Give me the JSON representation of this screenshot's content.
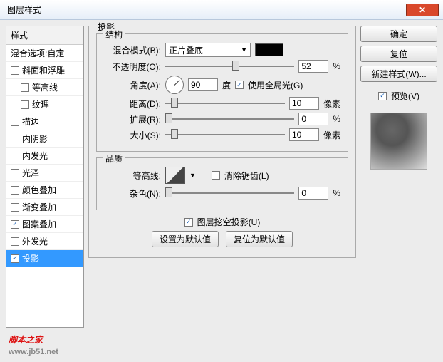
{
  "title": "图层样式",
  "styles": {
    "header": "样式",
    "blend_opts": "混合选项:自定",
    "items": [
      {
        "label": "斜面和浮雕",
        "checked": false,
        "indent": false
      },
      {
        "label": "等高线",
        "checked": false,
        "indent": true
      },
      {
        "label": "纹理",
        "checked": false,
        "indent": true
      },
      {
        "label": "描边",
        "checked": false,
        "indent": false
      },
      {
        "label": "内阴影",
        "checked": false,
        "indent": false
      },
      {
        "label": "内发光",
        "checked": false,
        "indent": false
      },
      {
        "label": "光泽",
        "checked": false,
        "indent": false
      },
      {
        "label": "颜色叠加",
        "checked": false,
        "indent": false
      },
      {
        "label": "渐变叠加",
        "checked": false,
        "indent": false
      },
      {
        "label": "图案叠加",
        "checked": true,
        "indent": false
      },
      {
        "label": "外发光",
        "checked": false,
        "indent": false
      },
      {
        "label": "投影",
        "checked": true,
        "indent": false,
        "selected": true
      }
    ]
  },
  "main": {
    "title": "投影",
    "structure": {
      "legend": "结构",
      "blend_mode_label": "混合模式(B):",
      "blend_mode_value": "正片叠底",
      "opacity_label": "不透明度(O):",
      "opacity_value": "52",
      "percent": "%",
      "angle_label": "角度(A):",
      "angle_value": "90",
      "degree": "度",
      "global_light": "使用全局光(G)",
      "distance_label": "距离(D):",
      "distance_value": "10",
      "px": "像素",
      "spread_label": "扩展(R):",
      "spread_value": "0",
      "size_label": "大小(S):",
      "size_value": "10"
    },
    "quality": {
      "legend": "品质",
      "contour_label": "等高线:",
      "antialias": "消除锯齿(L)",
      "noise_label": "杂色(N):",
      "noise_value": "0"
    },
    "knockout": "图层挖空投影(U)",
    "set_default": "设置为默认值",
    "reset_default": "复位为默认值"
  },
  "buttons": {
    "ok": "确定",
    "reset": "复位",
    "new_style": "新建样式(W)...",
    "preview": "预览(V)"
  },
  "watermark": {
    "text": "脚本之家",
    "url": "www.jb51.net"
  }
}
